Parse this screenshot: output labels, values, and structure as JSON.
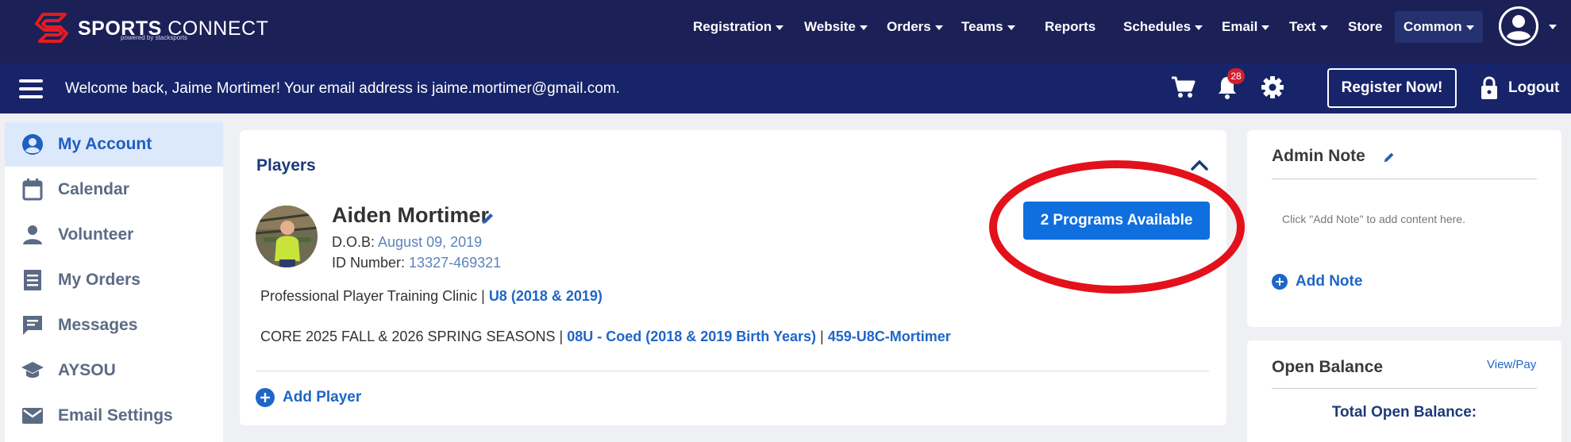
{
  "brand": {
    "name_bold": "SPORTS",
    "name_light": "CONNECT",
    "powered_by": "powered by stacksports",
    "red": "#e31b23",
    "navy": "#1b2157"
  },
  "topnav": {
    "items": [
      {
        "label": "Registration",
        "has_caret": true
      },
      {
        "label": "Website",
        "has_caret": true
      },
      {
        "label": "Orders",
        "has_caret": true
      },
      {
        "label": "Teams",
        "has_caret": true
      },
      {
        "label": "Reports",
        "has_caret": false
      },
      {
        "label": "Schedules",
        "has_caret": true
      },
      {
        "label": "Email",
        "has_caret": true
      },
      {
        "label": "Text",
        "has_caret": true
      },
      {
        "label": "Store",
        "has_caret": false
      },
      {
        "label": "Common",
        "has_caret": true
      }
    ]
  },
  "subbar": {
    "welcome": "Welcome back, Jaime Mortimer! Your email address is jaime.mortimer@gmail.com.",
    "notification_count": "28",
    "register_label": "Register Now!",
    "logout_label": "Logout"
  },
  "sidebar": {
    "items": [
      {
        "label": "My Account",
        "icon": "account-circle-icon",
        "active": true
      },
      {
        "label": "Calendar",
        "icon": "calendar-icon",
        "active": false
      },
      {
        "label": "Volunteer",
        "icon": "person-icon",
        "active": false
      },
      {
        "label": "My Orders",
        "icon": "receipt-icon",
        "active": false
      },
      {
        "label": "Messages",
        "icon": "message-icon",
        "active": false
      },
      {
        "label": "AYSOU",
        "icon": "graduation-cap-icon",
        "active": false
      },
      {
        "label": "Email Settings",
        "icon": "envelope-icon",
        "active": false
      }
    ]
  },
  "players": {
    "title": "Players",
    "player": {
      "name": "Aiden Mortimer",
      "dob_label": "D.O.B:",
      "dob_value": "August 09, 2019",
      "id_label": "ID Number:",
      "id_value": "13327-469321"
    },
    "programs_button": "2 Programs Available",
    "programs": [
      {
        "name": "Professional Player Training Clinic",
        "division": "U8 (2018 & 2019)",
        "team": ""
      },
      {
        "name": "CORE 2025 FALL & 2026 SPRING SEASONS",
        "division": "08U - Coed (2018 & 2019 Birth Years)",
        "team": "459-U8C-Mortimer"
      }
    ],
    "add_player_label": "Add Player"
  },
  "admin_note": {
    "title": "Admin Note",
    "hint": "Click \"Add Note\" to add content here.",
    "add_label": "Add Note"
  },
  "balance": {
    "title": "Open Balance",
    "view_pay": "View/Pay",
    "total_label": "Total Open Balance:"
  }
}
